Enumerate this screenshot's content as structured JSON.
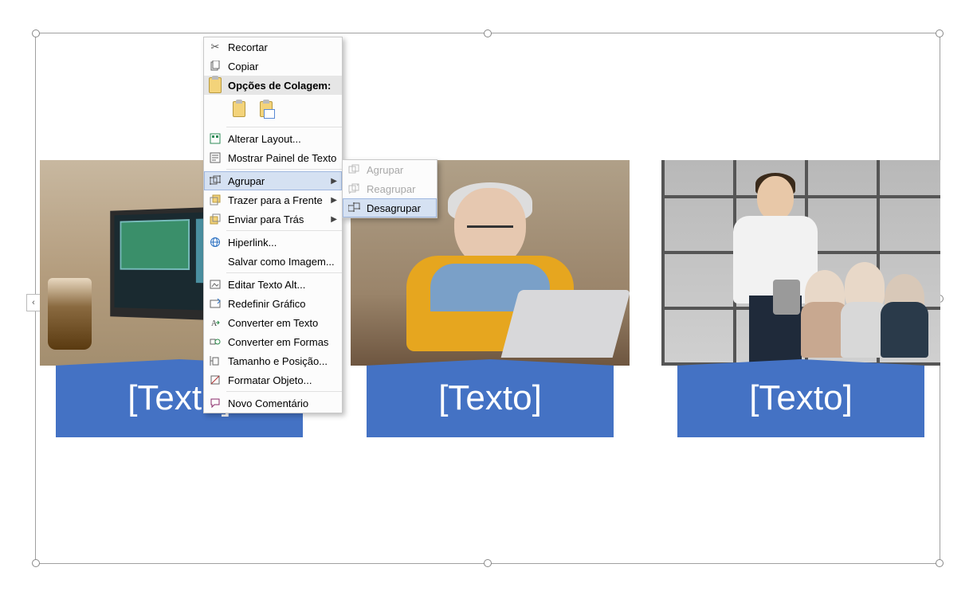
{
  "smartart": {
    "items": [
      {
        "caption": "[Texto]"
      },
      {
        "caption": "[Texto]"
      },
      {
        "caption": "[Texto]"
      }
    ]
  },
  "context_menu": {
    "cut": "Recortar",
    "copy": "Copiar",
    "paste_header": "Opções de Colagem:",
    "change_layout": "Alterar Layout...",
    "show_text_pane": "Mostrar Painel de Texto",
    "group": "Agrupar",
    "bring_front": "Trazer para a Frente",
    "send_back": "Enviar para Trás",
    "hyperlink": "Hiperlink...",
    "save_as_image": "Salvar como Imagem...",
    "edit_alt_text": "Editar Texto Alt...",
    "reset_graphic": "Redefinir Gráfico",
    "convert_text": "Converter em Texto",
    "convert_shapes": "Converter em Formas",
    "size_position": "Tamanho e Posição...",
    "format_object": "Formatar Objeto...",
    "new_comment": "Novo Comentário"
  },
  "submenu_group": {
    "group": "Agrupar",
    "regroup": "Reagrupar",
    "ungroup": "Desagrupar"
  }
}
